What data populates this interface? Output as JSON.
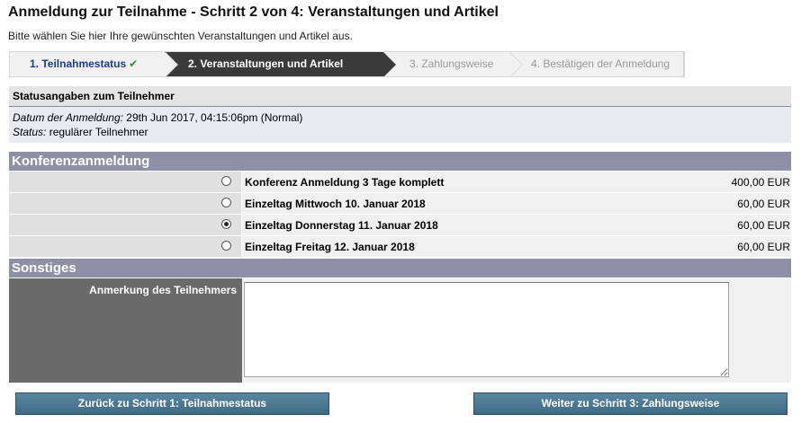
{
  "page": {
    "title": "Anmeldung zur Teilnahme - Schritt 2 von 4: Veranstaltungen und Artikel",
    "subtitle": "Bitte wählen Sie hier Ihre gewünschten Veranstaltungen und Artikel aus."
  },
  "steps": [
    {
      "label": "1. Teilnahmestatus",
      "state": "done",
      "check": "✔"
    },
    {
      "label": "2. Veranstaltungen und Artikel",
      "state": "active"
    },
    {
      "label": "3. Zahlungsweise",
      "state": "todo"
    },
    {
      "label": "4. Bestätigen der Anmeldung",
      "state": "todo"
    }
  ],
  "status": {
    "heading": "Statusangaben zum Teilnehmer",
    "date_label": "Datum der Anmeldung:",
    "date_value": "29th Jun 2017, 04:15:06pm (Normal)",
    "status_label": "Status:",
    "status_value": "regulärer Teilnehmer"
  },
  "konferenz": {
    "heading": "Konferenzanmeldung",
    "options": [
      {
        "name": "Konferenz Anmeldung 3 Tage komplett",
        "price": "400,00 EUR",
        "selected": false
      },
      {
        "name": "Einzeltag Mittwoch 10. Januar 2018",
        "price": "60,00 EUR",
        "selected": false
      },
      {
        "name": "Einzeltag Donnerstag 11. Januar 2018",
        "price": "60,00 EUR",
        "selected": true
      },
      {
        "name": "Einzeltag Freitag 12. Januar 2018",
        "price": "60,00 EUR",
        "selected": false
      }
    ]
  },
  "sonstiges": {
    "heading": "Sonstiges",
    "comment_label": "Anmerkung des Teilnehmers",
    "comment_value": ""
  },
  "buttons": {
    "back": "Zurück zu Schritt 1: Teilnahmestatus",
    "next": "Weiter zu Schritt 3: Zahlungsweise"
  }
}
